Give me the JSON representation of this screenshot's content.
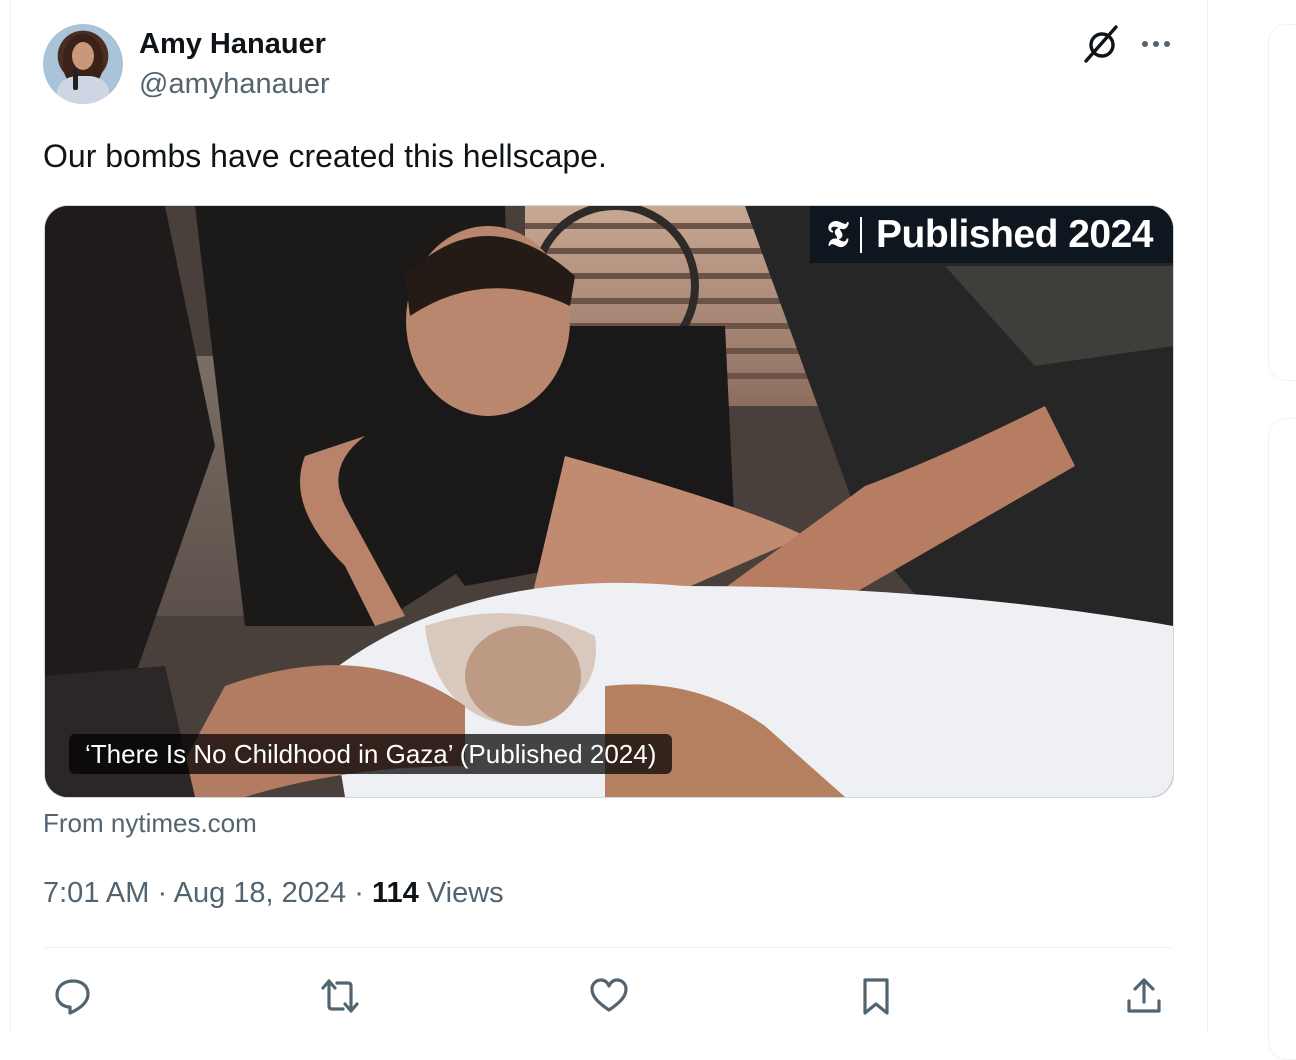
{
  "author": {
    "name": "Amy Hanauer",
    "handle": "@amyhanauer"
  },
  "tweet": {
    "text": "Our bombs have created this hellscape."
  },
  "card": {
    "badge_logo": "𝕿",
    "badge_text": "Published 2024",
    "caption": "‘There Is No Childhood in Gaza’ (Published 2024)",
    "source": "From nytimes.com"
  },
  "meta": {
    "time": "7:01 AM",
    "date": "Aug 18, 2024",
    "separator": "·",
    "views_count": "114",
    "views_label": "Views"
  },
  "actions": [
    {
      "name": "reply",
      "icon": "reply-icon"
    },
    {
      "name": "repost",
      "icon": "repost-icon"
    },
    {
      "name": "like",
      "icon": "like-icon"
    },
    {
      "name": "bookmark",
      "icon": "bookmark-icon"
    },
    {
      "name": "share",
      "icon": "share-icon"
    }
  ],
  "colors": {
    "text_primary": "#0f1419",
    "text_secondary": "#536471",
    "border": "#cfd9de",
    "divider": "#eff3f4",
    "badge_bg": "#0e1620"
  }
}
